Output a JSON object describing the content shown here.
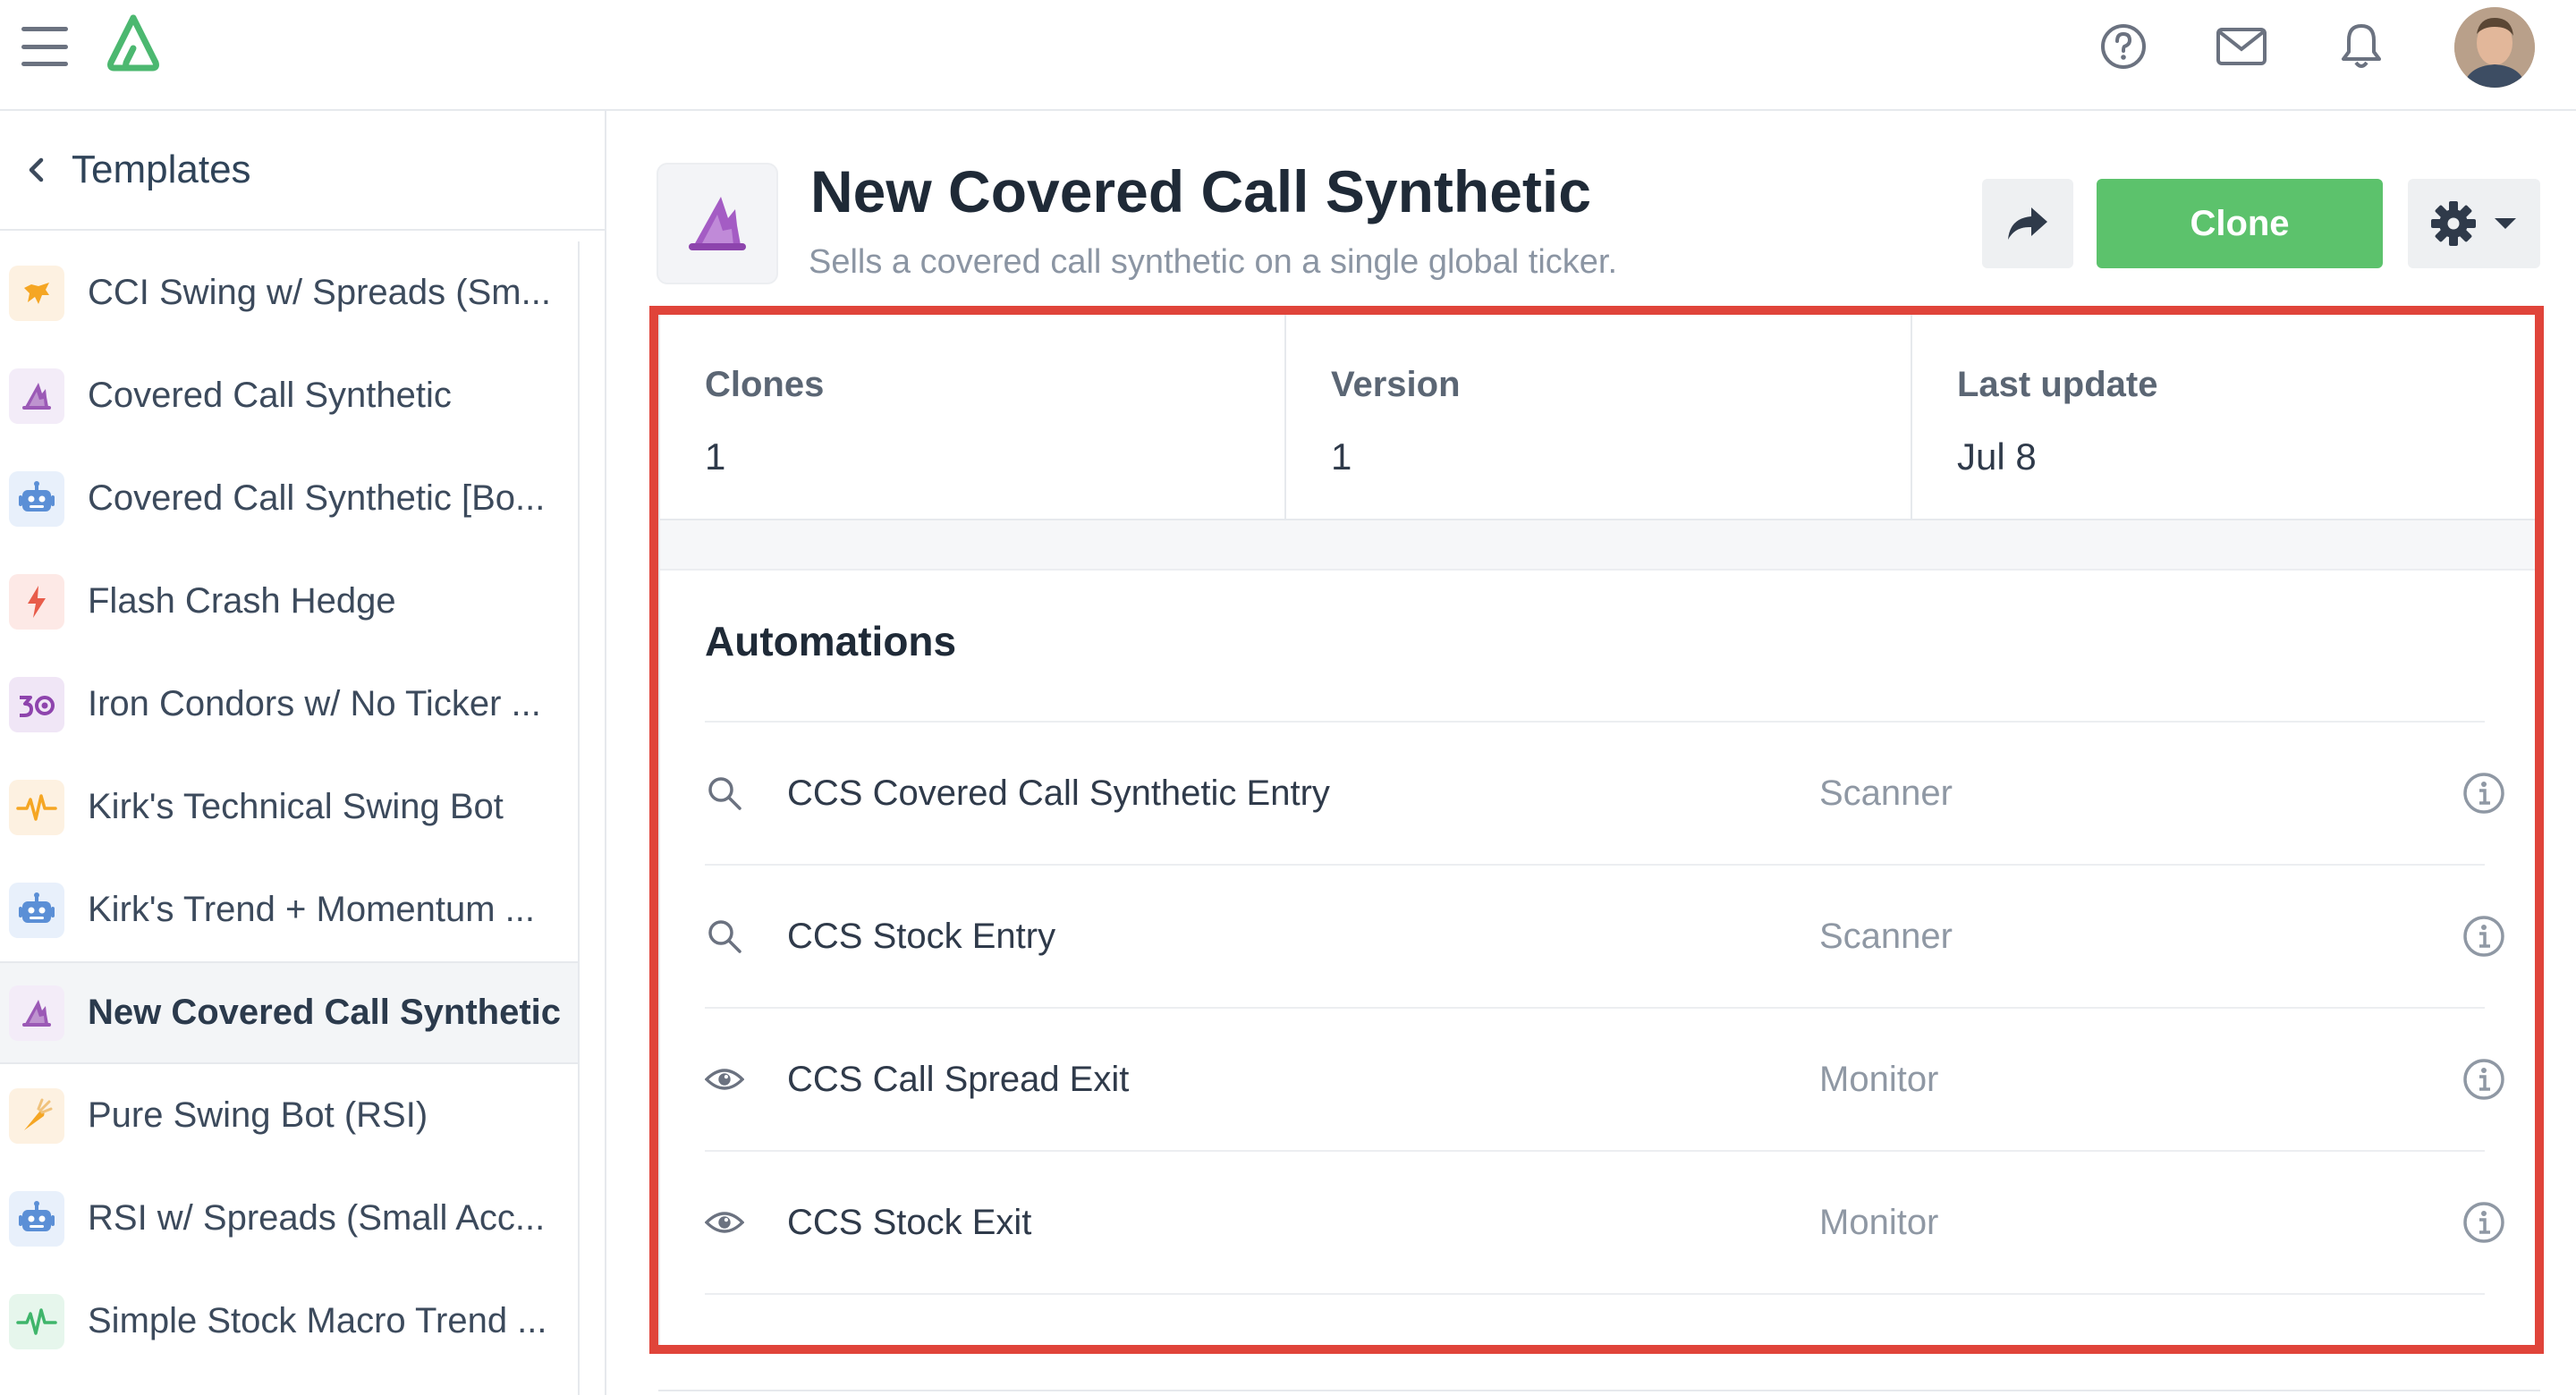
{
  "sidebar": {
    "title": "Templates",
    "items": [
      {
        "label": "CCI Swing w/ Spreads (Sm...",
        "icon": "bull-icon",
        "color": "#f5a623",
        "bg": "#fdf1e1"
      },
      {
        "label": "Covered Call Synthetic",
        "icon": "wizard-hat-icon",
        "color": "#9b59b6",
        "bg": "#f3ecf8"
      },
      {
        "label": "Covered Call Synthetic [Bo...",
        "icon": "robot-icon",
        "color": "#5b8fd6",
        "bg": "#e8f0fb"
      },
      {
        "label": "Flash Crash Hedge",
        "icon": "lightning-icon",
        "color": "#e85c4a",
        "bg": "#fde9e6"
      },
      {
        "label": "Iron Condors w/ No Ticker ...",
        "icon": "condor-icon",
        "color": "#8e44ad",
        "bg": "#f0e6f6"
      },
      {
        "label": "Kirk's Technical Swing Bot",
        "icon": "pulse-icon",
        "color": "#f5a623",
        "bg": "#fdf1e1"
      },
      {
        "label": "Kirk's Trend + Momentum ...",
        "icon": "robot-icon",
        "color": "#5b8fd6",
        "bg": "#e8f0fb"
      },
      {
        "label": "New Covered Call Synthetic",
        "icon": "wizard-hat-icon",
        "color": "#9b59b6",
        "bg": "#f3ecf8",
        "active": true
      },
      {
        "label": "Pure Swing Bot (RSI)",
        "icon": "carrot-icon",
        "color": "#f5a623",
        "bg": "#fdf1e1"
      },
      {
        "label": "RSI w/ Spreads (Small Acc...",
        "icon": "robot-icon",
        "color": "#5b8fd6",
        "bg": "#e8f0fb"
      },
      {
        "label": "Simple Stock Macro Trend ...",
        "icon": "pulse-icon",
        "color": "#3fb56b",
        "bg": "#e6f6ec"
      }
    ]
  },
  "header": {
    "title": "New Covered Call Synthetic",
    "subtitle": "Sells a covered call synthetic on a single global ticker.",
    "clone_label": "Clone"
  },
  "stats": [
    {
      "label": "Clones",
      "value": "1"
    },
    {
      "label": "Version",
      "value": "1"
    },
    {
      "label": "Last update",
      "value": "Jul 8"
    }
  ],
  "automations": {
    "title": "Automations",
    "rows": [
      {
        "name": "CCS Covered Call Synthetic Entry",
        "type": "Scanner",
        "icon": "search-icon"
      },
      {
        "name": "CCS Stock Entry",
        "type": "Scanner",
        "icon": "search-icon"
      },
      {
        "name": "CCS Call Spread Exit",
        "type": "Monitor",
        "icon": "eye-icon"
      },
      {
        "name": "CCS Stock Exit",
        "type": "Monitor",
        "icon": "eye-icon"
      }
    ]
  },
  "colors": {
    "accent": "#5cc26c",
    "highlight": "#e0443a"
  }
}
